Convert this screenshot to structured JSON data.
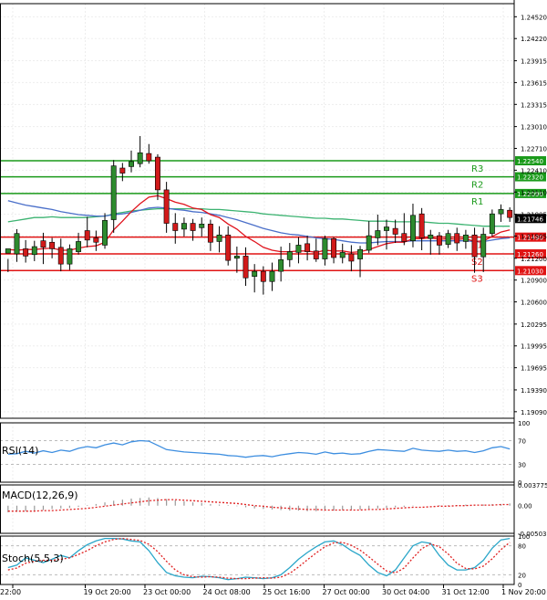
{
  "colors": {
    "up": "#2e8b2e",
    "down": "#d11a1a",
    "ema_blue": "#4a6fc9",
    "ema_green": "#3cb371",
    "ema_red": "#e0141e",
    "resistance": "#1a9a1a",
    "support": "#e01414",
    "rsi": "#3d8ee0",
    "macd": "#999999",
    "signal": "#e02020",
    "stoch_k": "#2aa6c9",
    "stoch_d": "#e02020",
    "grid": "#ededed",
    "frame": "#000000"
  },
  "chart_data": [
    {
      "type": "candlestick",
      "panel": "price",
      "ylim": [
        1.19,
        1.247
      ],
      "y_ticks": [
        "1.24520",
        "1.24220",
        "1.23915",
        "1.23615",
        "1.23315",
        "1.23010",
        "1.22710",
        "1.22410",
        "1.22110",
        "1.21805",
        "1.21505",
        "1.21200",
        "1.20900",
        "1.20600",
        "1.20295",
        "1.19995",
        "1.19695",
        "1.19390",
        "1.19090"
      ],
      "current_price": "1.21746",
      "x_tick_labels": [
        "22:00",
        "19 Oct 20:00",
        "23 Oct 00:00",
        "24 Oct 08:00",
        "25 Oct 16:00",
        "27 Oct 00:00",
        "30 Oct 04:00",
        "31 Oct 12:00",
        "1 Nov 20:00"
      ],
      "levels": [
        {
          "name": "R3",
          "value": 1.2254,
          "label": "1.22540",
          "kind": "resistance"
        },
        {
          "name": "R2",
          "value": 1.2232,
          "label": "1.22320",
          "kind": "resistance"
        },
        {
          "name": "R1",
          "value": 1.2209,
          "label": "1.22090",
          "kind": "resistance"
        },
        {
          "name": "S1",
          "value": 1.2149,
          "label": "1.21490",
          "kind": "support"
        },
        {
          "name": "S2",
          "value": 1.2126,
          "label": "1.21260",
          "kind": "support"
        },
        {
          "name": "S3",
          "value": 1.2103,
          "label": "1.21030",
          "kind": "support"
        }
      ],
      "candles": [
        [
          1.2127,
          1.2133,
          1.2119,
          1.2101
        ],
        [
          1.2126,
          1.2154,
          1.216,
          1.2115
        ],
        [
          1.2133,
          1.2123,
          1.2145,
          1.2114
        ],
        [
          1.2125,
          1.2136,
          1.2144,
          1.2116
        ],
        [
          1.2144,
          1.2135,
          1.2155,
          1.2112
        ],
        [
          1.2142,
          1.2133,
          1.2148,
          1.212
        ],
        [
          1.2135,
          1.2112,
          1.2147,
          1.2102
        ],
        [
          1.2112,
          1.2133,
          1.2139,
          1.2104
        ],
        [
          1.2129,
          1.2143,
          1.2155,
          1.2125
        ],
        [
          1.2158,
          1.2145,
          1.2177,
          1.2135
        ],
        [
          1.2148,
          1.2142,
          1.2158,
          1.213
        ],
        [
          1.2138,
          1.2172,
          1.2182,
          1.2133
        ],
        [
          1.2173,
          1.2247,
          1.2255,
          1.2155
        ],
        [
          1.2244,
          1.2237,
          1.2251,
          1.2226
        ],
        [
          1.2246,
          1.2253,
          1.2268,
          1.2238
        ],
        [
          1.225,
          1.2265,
          1.2288,
          1.2245
        ],
        [
          1.2264,
          1.2254,
          1.2277,
          1.225
        ],
        [
          1.2259,
          1.2214,
          1.2263,
          1.22
        ],
        [
          1.2214,
          1.2168,
          1.2225,
          1.2155
        ],
        [
          1.2168,
          1.2158,
          1.2182,
          1.214
        ],
        [
          1.216,
          1.2168,
          1.2176,
          1.215
        ],
        [
          1.2168,
          1.2158,
          1.2174,
          1.2144
        ],
        [
          1.2162,
          1.2167,
          1.2176,
          1.215
        ],
        [
          1.2167,
          1.2142,
          1.2173,
          1.213
        ],
        [
          1.2143,
          1.2152,
          1.2164,
          1.2128
        ],
        [
          1.2152,
          1.2117,
          1.2164,
          1.211
        ],
        [
          1.212,
          1.2123,
          1.2136,
          1.21
        ],
        [
          1.2123,
          1.2093,
          1.2135,
          1.2082
        ],
        [
          1.2095,
          1.2102,
          1.2112,
          1.2073
        ],
        [
          1.2102,
          1.2088,
          1.2109,
          1.207
        ],
        [
          1.2088,
          1.2102,
          1.2114,
          1.2075
        ],
        [
          1.2102,
          1.2118,
          1.2136,
          1.2088
        ],
        [
          1.2118,
          1.2129,
          1.2141,
          1.2108
        ],
        [
          1.2128,
          1.2138,
          1.2149,
          1.2113
        ],
        [
          1.214,
          1.2129,
          1.2151,
          1.2117
        ],
        [
          1.213,
          1.2119,
          1.2147,
          1.2115
        ],
        [
          1.2119,
          1.2147,
          1.2151,
          1.211
        ],
        [
          1.2147,
          1.2121,
          1.2149,
          1.2113
        ],
        [
          1.2121,
          1.2128,
          1.214,
          1.2113
        ],
        [
          1.2126,
          1.2116,
          1.2138,
          1.2102
        ],
        [
          1.2119,
          1.2132,
          1.2137,
          1.2094
        ],
        [
          1.2131,
          1.2151,
          1.2171,
          1.2127
        ],
        [
          1.2148,
          1.2158,
          1.218,
          1.2138
        ],
        [
          1.2158,
          1.2163,
          1.2173,
          1.2132
        ],
        [
          1.2161,
          1.2153,
          1.2173,
          1.2141
        ],
        [
          1.2154,
          1.2143,
          1.2182,
          1.2138
        ],
        [
          1.2144,
          1.2179,
          1.2195,
          1.2135
        ],
        [
          1.2181,
          1.2148,
          1.2189,
          1.2131
        ],
        [
          1.2147,
          1.2152,
          1.2159,
          1.2125
        ],
        [
          1.2151,
          1.2138,
          1.2156,
          1.2125
        ],
        [
          1.2139,
          1.2154,
          1.2159,
          1.2134
        ],
        [
          1.2154,
          1.2141,
          1.2162,
          1.213
        ],
        [
          1.2143,
          1.2152,
          1.2159,
          1.2133
        ],
        [
          1.2152,
          1.2122,
          1.2162,
          1.21
        ],
        [
          1.2122,
          1.2153,
          1.2162,
          1.2101
        ],
        [
          1.2154,
          1.2181,
          1.2187,
          1.215
        ],
        [
          1.2181,
          1.2187,
          1.2194,
          1.217
        ],
        [
          1.2186,
          1.2176,
          1.219,
          1.217
        ]
      ],
      "ema_fast": [
        1.2132,
        1.2131,
        1.2132,
        1.2132,
        1.2133,
        1.2134,
        1.2131,
        1.2131,
        1.2134,
        1.2136,
        1.2137,
        1.2142,
        1.2159,
        1.2171,
        1.2184,
        1.2195,
        1.2204,
        1.2206,
        1.2202,
        1.2197,
        1.2194,
        1.2189,
        1.2187,
        1.218,
        1.2176,
        1.2167,
        1.216,
        1.215,
        1.2143,
        1.2135,
        1.2131,
        1.2129,
        1.2129,
        1.213,
        1.213,
        1.2128,
        1.2131,
        1.213,
        1.213,
        1.2128,
        1.2129,
        1.2132,
        1.2136,
        1.214,
        1.2142,
        1.2142,
        1.2147,
        1.2147,
        1.2148,
        1.2146,
        1.2147,
        1.2146,
        1.2147,
        1.2143,
        1.2144,
        1.215,
        1.2156,
        1.2159
      ],
      "ema_mid": [
        1.2199,
        1.2196,
        1.2193,
        1.2191,
        1.2189,
        1.2187,
        1.2184,
        1.2182,
        1.218,
        1.2179,
        1.2178,
        1.2178,
        1.218,
        1.2181,
        1.2183,
        1.2186,
        1.2189,
        1.219,
        1.2189,
        1.2187,
        1.2186,
        1.2184,
        1.2183,
        1.2181,
        1.2179,
        1.2176,
        1.2173,
        1.2169,
        1.2165,
        1.2161,
        1.2158,
        1.2155,
        1.2153,
        1.2152,
        1.215,
        1.2148,
        1.2147,
        1.2146,
        1.2144,
        1.2142,
        1.2141,
        1.2141,
        1.2142,
        1.2143,
        1.2143,
        1.2143,
        1.2144,
        1.2144,
        1.2144,
        1.2144,
        1.2144,
        1.2144,
        1.2144,
        1.2143,
        1.2143,
        1.2145,
        1.2147,
        1.2148
      ],
      "ema_slow": [
        1.217,
        1.2172,
        1.2174,
        1.2176,
        1.2176,
        1.2177,
        1.2176,
        1.2176,
        1.2176,
        1.2176,
        1.2177,
        1.2178,
        1.2181,
        1.2183,
        1.2185,
        1.2186,
        1.2187,
        1.2188,
        1.2188,
        1.2188,
        1.2188,
        1.2188,
        1.2188,
        1.2187,
        1.2187,
        1.2186,
        1.2185,
        1.2184,
        1.2183,
        1.2181,
        1.218,
        1.2179,
        1.2178,
        1.2177,
        1.2176,
        1.2175,
        1.2175,
        1.2174,
        1.2174,
        1.2173,
        1.2172,
        1.2171,
        1.2171,
        1.2171,
        1.217,
        1.217,
        1.217,
        1.217,
        1.2169,
        1.2168,
        1.2168,
        1.2167,
        1.2166,
        1.2165,
        1.2164,
        1.2164,
        1.2164,
        1.2164
      ]
    },
    {
      "type": "line",
      "panel": "rsi",
      "label": "RSI(14)",
      "ylim": [
        0,
        100
      ],
      "y_ticks": [
        "100",
        "70",
        "30",
        "0"
      ],
      "values": [
        47,
        48,
        52,
        49,
        53,
        50,
        54,
        52,
        57,
        60,
        58,
        63,
        66,
        63,
        68,
        70,
        69,
        62,
        55,
        53,
        51,
        50,
        49,
        48,
        47,
        45,
        44,
        42,
        44,
        45,
        43,
        46,
        48,
        50,
        49,
        47,
        51,
        48,
        49,
        47,
        48,
        52,
        55,
        54,
        53,
        52,
        57,
        54,
        53,
        52,
        54,
        52,
        53,
        50,
        53,
        58,
        60,
        56
      ]
    },
    {
      "type": "bar",
      "panel": "macd",
      "label": "MACD(12,26,9)",
      "ylim": [
        -0.005032,
        0.003775
      ],
      "y_ticks": [
        "0.003775",
        "0.00",
        "-0.005032"
      ],
      "values": [
        -0.0012,
        -0.0011,
        -0.001,
        -0.0009,
        -0.0008,
        -0.0006,
        -0.0005,
        -0.0004,
        -0.0002,
        0.0001,
        0.0003,
        0.0006,
        0.0009,
        0.0011,
        0.0013,
        0.0014,
        0.0015,
        0.0014,
        0.0012,
        0.001,
        0.0008,
        0.0006,
        0.0005,
        0.0003,
        0.0002,
        0.0001,
        -0.0001,
        -0.0003,
        -0.0005,
        -0.0006,
        -0.0007,
        -0.0008,
        -0.0009,
        -0.0009,
        -0.001,
        -0.001,
        -0.0009,
        -0.0009,
        -0.0008,
        -0.0008,
        -0.0007,
        -0.0006,
        -0.0005,
        -0.0004,
        -0.0003,
        -0.0002,
        -0.0001,
        0.0,
        0.0,
        0.0001,
        0.0001,
        0.0001,
        0.0002,
        0.0002,
        0.0002,
        0.0003,
        0.0003,
        0.0004
      ],
      "signal": [
        -0.001,
        -0.001,
        -0.001,
        -0.001,
        -0.0009,
        -0.0009,
        -0.0008,
        -0.0007,
        -0.0006,
        -0.0005,
        -0.0003,
        -0.0001,
        0.0001,
        0.0003,
        0.0005,
        0.0007,
        0.0009,
        0.001,
        0.0011,
        0.0011,
        0.001,
        0.0009,
        0.0008,
        0.0007,
        0.0006,
        0.0005,
        0.0004,
        0.0002,
        0.0,
        -0.0001,
        -0.0003,
        -0.0004,
        -0.0005,
        -0.0006,
        -0.0007,
        -0.0007,
        -0.0008,
        -0.0008,
        -0.0008,
        -0.0008,
        -0.0008,
        -0.0007,
        -0.0007,
        -0.0006,
        -0.0005,
        -0.0004,
        -0.0003,
        -0.0003,
        -0.0002,
        -0.0001,
        -0.0001,
        0.0,
        0.0,
        0.0001,
        0.0001,
        0.0001,
        0.0002,
        0.0002
      ]
    },
    {
      "type": "line",
      "panel": "stoch",
      "label": "Stoch(5,5,3)",
      "ylim": [
        0,
        100
      ],
      "y_ticks": [
        "100",
        "80",
        "20",
        "0"
      ],
      "k": [
        35,
        40,
        55,
        50,
        45,
        52,
        60,
        55,
        70,
        82,
        90,
        95,
        95,
        94,
        90,
        88,
        70,
        45,
        25,
        18,
        15,
        14,
        17,
        16,
        14,
        10,
        12,
        15,
        14,
        12,
        14,
        20,
        35,
        52,
        66,
        78,
        88,
        90,
        82,
        70,
        60,
        40,
        25,
        18,
        30,
        55,
        80,
        88,
        85,
        60,
        40,
        30,
        30,
        35,
        50,
        75,
        92,
        95
      ],
      "d": [
        30,
        34,
        44,
        48,
        50,
        50,
        52,
        55,
        62,
        70,
        80,
        88,
        93,
        95,
        93,
        91,
        83,
        68,
        48,
        30,
        20,
        16,
        15,
        16,
        15,
        13,
        12,
        12,
        13,
        14,
        13,
        15,
        23,
        36,
        51,
        65,
        78,
        86,
        87,
        81,
        71,
        57,
        42,
        28,
        24,
        34,
        55,
        74,
        84,
        78,
        63,
        44,
        33,
        32,
        38,
        53,
        72,
        87
      ]
    }
  ],
  "panels": {
    "rsi_label": "RSI(14)",
    "macd_label": "MACD(12,26,9)",
    "stoch_label": "Stoch(5,5,3)"
  }
}
